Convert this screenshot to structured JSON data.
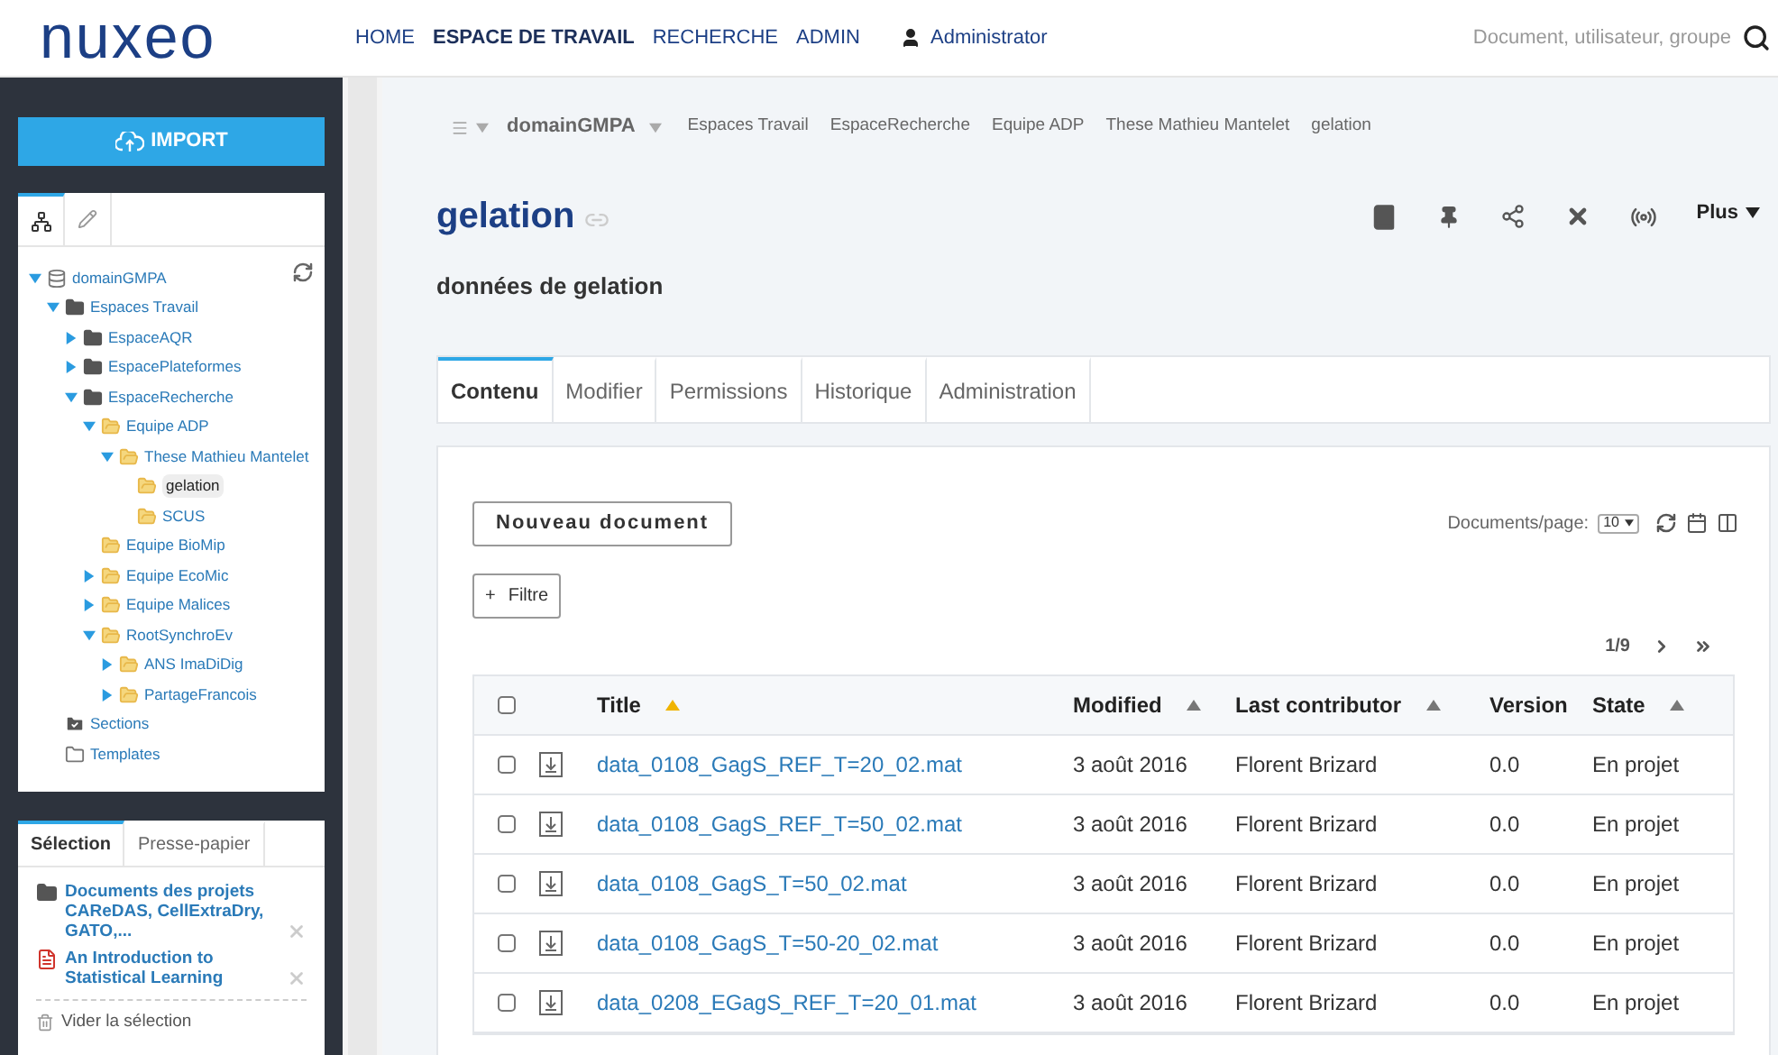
{
  "header": {
    "logo": "nuxeo",
    "nav": [
      {
        "label": "HOME",
        "selected": false
      },
      {
        "label": "ESPACE DE TRAVAIL",
        "selected": true
      },
      {
        "label": "RECHERCHE",
        "selected": false
      },
      {
        "label": "ADMIN",
        "selected": false
      }
    ],
    "user": "Administrator",
    "search": {
      "placeholder": "Document, utilisateur, groupe"
    }
  },
  "sidebar": {
    "import_button": "IMPORT",
    "tree": [
      {
        "label": "domainGMPA",
        "kind": "domain",
        "expanded": true,
        "selected": false,
        "children": [
          {
            "label": "Espaces Travail",
            "kind": "folder-dark",
            "expanded": true,
            "selected": false,
            "children": [
              {
                "label": "EspaceAQR",
                "kind": "folder-dark",
                "expanded": false,
                "selected": false
              },
              {
                "label": "EspacePlateformes",
                "kind": "folder-dark",
                "expanded": false,
                "selected": false
              },
              {
                "label": "EspaceRecherche",
                "kind": "folder-dark",
                "expanded": true,
                "selected": false,
                "children": [
                  {
                    "label": "Equipe ADP",
                    "kind": "folder",
                    "expanded": true,
                    "selected": false,
                    "children": [
                      {
                        "label": "These Mathieu Mantelet",
                        "kind": "folder",
                        "expanded": true,
                        "selected": false,
                        "children": [
                          {
                            "label": "gelation",
                            "kind": "folder",
                            "selected": true
                          },
                          {
                            "label": "SCUS",
                            "kind": "folder",
                            "selected": false
                          }
                        ]
                      }
                    ]
                  },
                  {
                    "label": "Equipe BioMip",
                    "kind": "folder",
                    "selected": false
                  },
                  {
                    "label": "Equipe EcoMic",
                    "kind": "folder",
                    "expanded": false,
                    "selected": false
                  },
                  {
                    "label": "Equipe Malices",
                    "kind": "folder",
                    "expanded": false,
                    "selected": false
                  },
                  {
                    "label": "RootSynchroEv",
                    "kind": "folder",
                    "expanded": true,
                    "selected": false,
                    "children": [
                      {
                        "label": "ANS ImaDiDig",
                        "kind": "folder",
                        "expanded": false,
                        "selected": false
                      },
                      {
                        "label": "PartageFrancois",
                        "kind": "folder",
                        "expanded": false,
                        "selected": false
                      }
                    ]
                  }
                ]
              }
            ]
          },
          {
            "label": "Sections",
            "kind": "sections",
            "selected": false
          },
          {
            "label": "Templates",
            "kind": "templates",
            "selected": false
          }
        ]
      }
    ],
    "selection_tabs": [
      {
        "label": "Sélection",
        "selected": true
      },
      {
        "label": "Presse-papier",
        "selected": false
      }
    ],
    "selection_items": [
      {
        "kind": "folder",
        "label": "Documents des projets CAReDAS, CellExtraDry, GATO,..."
      },
      {
        "kind": "pdf",
        "label": "An Introduction to Statistical Learning"
      }
    ],
    "clear_selection": "Vider la sélection"
  },
  "breadcrumb": {
    "root": "domainGMPA",
    "items": [
      "Espaces Travail",
      "EspaceRecherche",
      "Equipe ADP",
      "These Mathieu Mantelet",
      "gelation"
    ]
  },
  "document": {
    "title": "gelation",
    "description": "données de gelation",
    "more_menu": "Plus"
  },
  "tabs": [
    {
      "label": "Contenu",
      "selected": true
    },
    {
      "label": "Modifier",
      "selected": false
    },
    {
      "label": "Permissions",
      "selected": false
    },
    {
      "label": "Historique",
      "selected": false
    },
    {
      "label": "Administration",
      "selected": false
    }
  ],
  "content": {
    "new_document_button": "Nouveau document",
    "page_size_label": "Documents/page:",
    "page_size": "10",
    "filter_button": "Filtre",
    "filter_icon": "+",
    "pagination": "1/9",
    "table": {
      "all_checked": false,
      "columns": [
        {
          "label": "Title",
          "sorted": true
        },
        {
          "label": "Modified",
          "sorted": false
        },
        {
          "label": "Last contributor",
          "sorted": false
        },
        {
          "label": "Version"
        },
        {
          "label": "State",
          "sorted": false
        }
      ],
      "rows": [
        {
          "title": "data_0108_GagS_REF_T=20_02.mat",
          "modified": "3 août 2016",
          "contributor": "Florent Brizard",
          "version": "0.0",
          "state": "En projet",
          "checked": false
        },
        {
          "title": "data_0108_GagS_REF_T=50_02.mat",
          "modified": "3 août 2016",
          "contributor": "Florent Brizard",
          "version": "0.0",
          "state": "En projet",
          "checked": false
        },
        {
          "title": "data_0108_GagS_T=50_02.mat",
          "modified": "3 août 2016",
          "contributor": "Florent Brizard",
          "version": "0.0",
          "state": "En projet",
          "checked": false
        },
        {
          "title": "data_0108_GagS_T=50-20_02.mat",
          "modified": "3 août 2016",
          "contributor": "Florent Brizard",
          "version": "0.0",
          "state": "En projet",
          "checked": false
        },
        {
          "title": "data_0208_EGagS_REF_T=20_01.mat",
          "modified": "3 août 2016",
          "contributor": "Florent Brizard",
          "version": "0.0",
          "state": "En projet",
          "checked": false
        }
      ]
    }
  }
}
